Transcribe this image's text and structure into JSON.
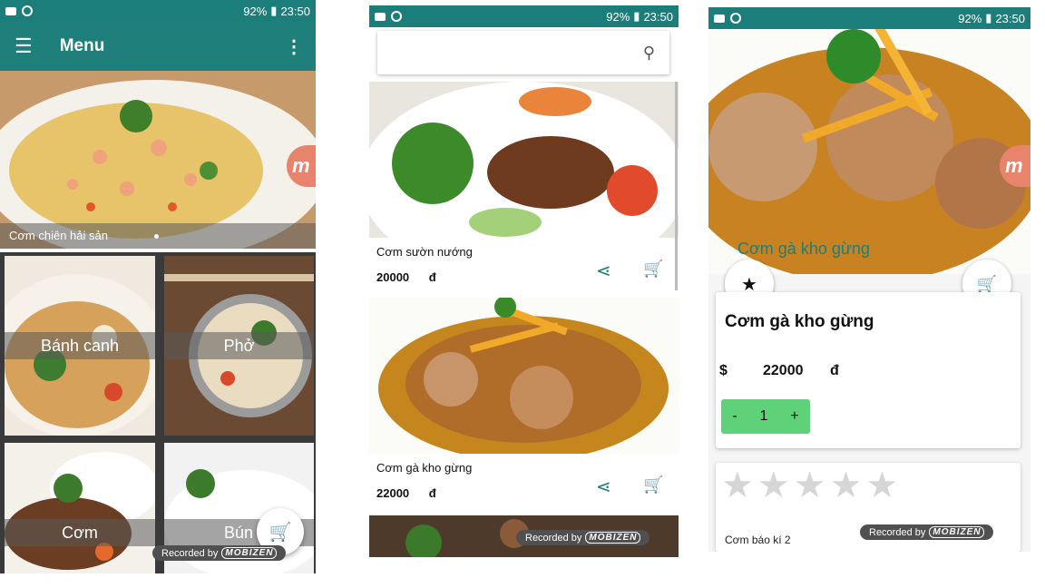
{
  "status": {
    "battery": "92%",
    "time": "23:50"
  },
  "screen1": {
    "title": "Menu",
    "hero_caption": "Cơm chiên hải sản",
    "categories": [
      {
        "label": "Bánh canh"
      },
      {
        "label": "Phở"
      },
      {
        "label": "Cơm"
      },
      {
        "label": "Bún"
      }
    ],
    "recorded": "Recorded by",
    "brand": "MOBIZEN"
  },
  "screen2": {
    "search_placeholder": "",
    "items": [
      {
        "name": "Cơm sườn nướng",
        "price": "20000",
        "currency": "đ"
      },
      {
        "name": "Cơm gà kho gừng",
        "price": "22000",
        "currency": "đ"
      }
    ],
    "recorded": "Recorded by",
    "brand": "MOBIZEN"
  },
  "screen3": {
    "image_caption": "Cơm gà kho gừng",
    "title": "Cơm gà kho gừng",
    "currency_symbol": "$",
    "price": "22000",
    "currency": "đ",
    "minus": "-",
    "quantity": "1",
    "plus": "+",
    "rating_stars": 5,
    "related": "Cơm báo kí 2",
    "recorded": "Recorded by",
    "brand": "MOBIZEN"
  },
  "colors": {
    "teal": "#1f7f7b",
    "green_btn": "#5fd178",
    "accent_teal": "#1b7e7a"
  }
}
